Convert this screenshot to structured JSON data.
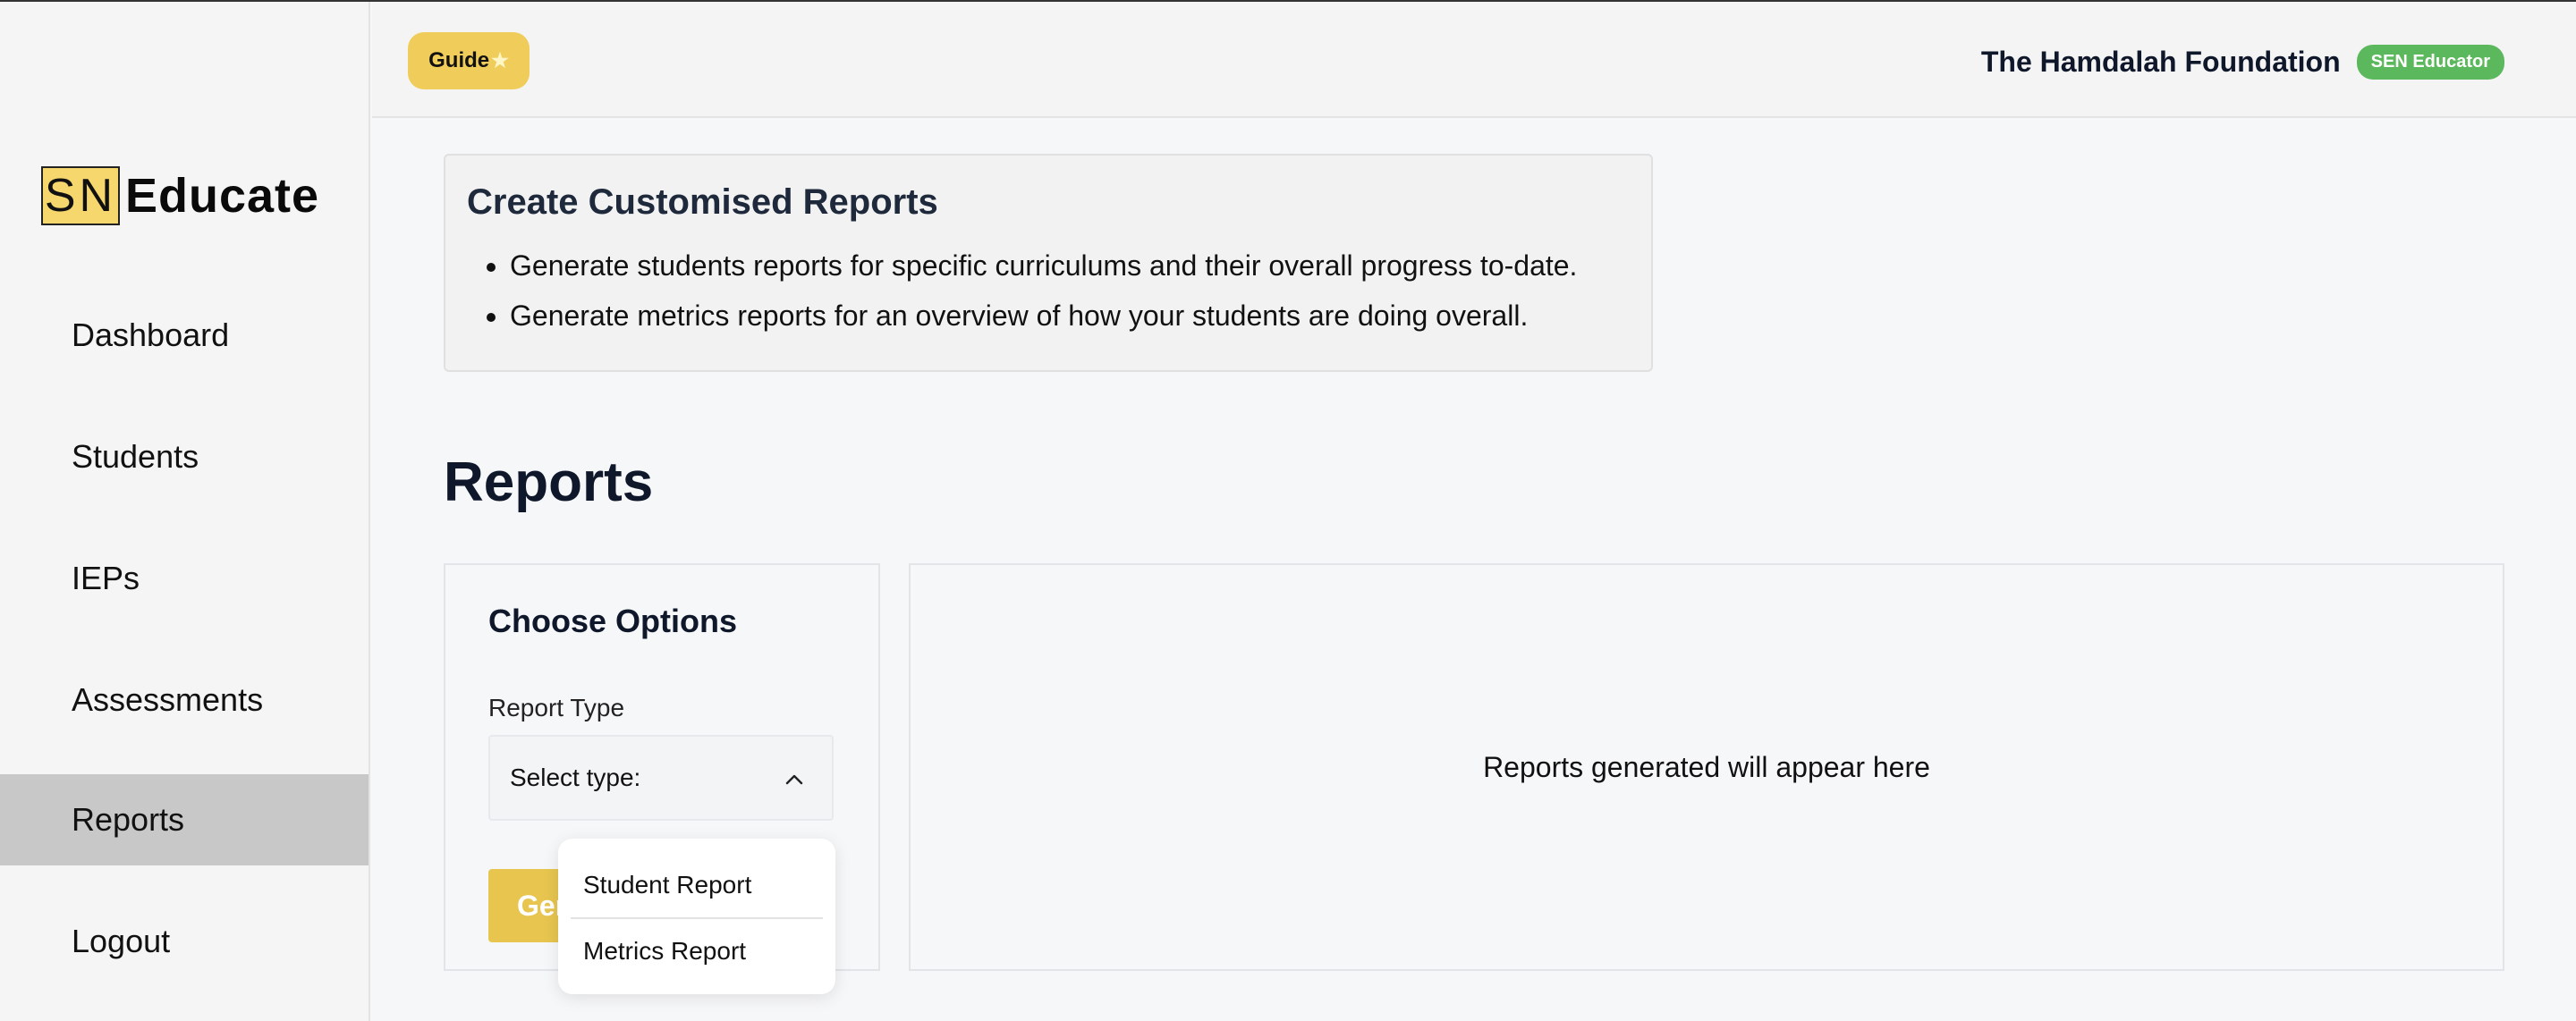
{
  "sidebar": {
    "logo_box": "SN",
    "logo_word": "Educate",
    "items": [
      {
        "label": "Dashboard"
      },
      {
        "label": "Students"
      },
      {
        "label": "IEPs"
      },
      {
        "label": "Assessments"
      },
      {
        "label": "Reports",
        "active": true
      },
      {
        "label": "Logout"
      }
    ]
  },
  "header": {
    "guide_label": "Guide",
    "guide_icon": "star-icon",
    "organization": "The Hamdalah Foundation",
    "role_badge": "SEN Educator",
    "role_badge_color": "#5cb85c"
  },
  "info": {
    "title": "Create Customised Reports",
    "bullets": [
      "Generate students reports for specific curriculums and their overall progress to-date.",
      "Generate metrics reports for an overview of how your students are doing overall."
    ]
  },
  "main": {
    "title": "Reports",
    "options": {
      "title": "Choose Options",
      "report_type_label": "Report Type",
      "select_placeholder": "Select type:",
      "generate_label": "Generate",
      "dropdown_options": [
        "Student Report",
        "Metrics Report"
      ]
    },
    "output": {
      "empty_message": "Reports generated will appear here"
    }
  },
  "colors": {
    "accent": "#f0cd5a",
    "active_nav": "#c8c8c8"
  }
}
